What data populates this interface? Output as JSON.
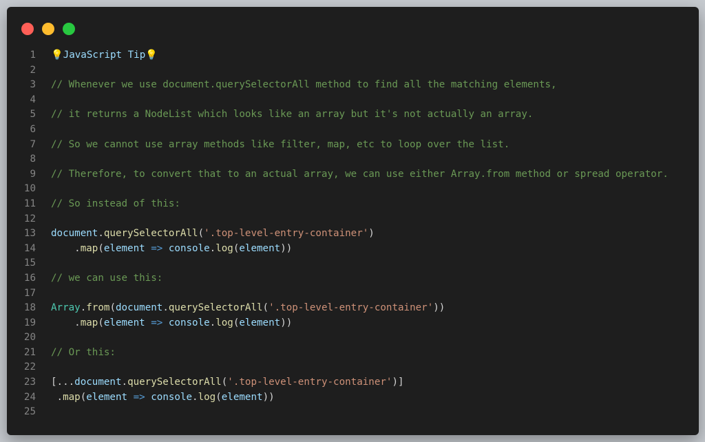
{
  "window": {
    "traffic_lights": {
      "close_color": "#ff5f57",
      "minimize_color": "#febc2e",
      "maximize_color": "#28c840"
    }
  },
  "code": {
    "lines": [
      {
        "n": "1",
        "tokens": [
          {
            "t": "bulb",
            "v": "💡"
          },
          {
            "t": "tip",
            "v": "JavaScript Tip"
          },
          {
            "t": "bulb",
            "v": "💡"
          }
        ]
      },
      {
        "n": "2",
        "tokens": []
      },
      {
        "n": "3",
        "tokens": [
          {
            "t": "cm",
            "v": "// Whenever we use document.querySelectorAll method to find all the matching elements,"
          }
        ]
      },
      {
        "n": "4",
        "tokens": []
      },
      {
        "n": "5",
        "tokens": [
          {
            "t": "cm",
            "v": "// it returns a NodeList which looks like an array but it's not actually an array."
          }
        ]
      },
      {
        "n": "6",
        "tokens": []
      },
      {
        "n": "7",
        "tokens": [
          {
            "t": "cm",
            "v": "// So we cannot use array methods like filter, map, etc to loop over the list."
          }
        ]
      },
      {
        "n": "8",
        "tokens": []
      },
      {
        "n": "9",
        "tokens": [
          {
            "t": "cm",
            "v": "// Therefore, to convert that to an actual array, we can use either Array.from method or spread operator."
          }
        ]
      },
      {
        "n": "10",
        "tokens": []
      },
      {
        "n": "11",
        "tokens": [
          {
            "t": "cm",
            "v": "// So instead of this:"
          }
        ]
      },
      {
        "n": "12",
        "tokens": []
      },
      {
        "n": "13",
        "tokens": [
          {
            "t": "vr",
            "v": "document"
          },
          {
            "t": "pl",
            "v": "."
          },
          {
            "t": "fn",
            "v": "querySelectorAll"
          },
          {
            "t": "pl",
            "v": "("
          },
          {
            "t": "st",
            "v": "'.top-level-entry-container'"
          },
          {
            "t": "pl",
            "v": ")"
          }
        ]
      },
      {
        "n": "14",
        "tokens": [
          {
            "t": "pl",
            "v": "    ."
          },
          {
            "t": "fn",
            "v": "map"
          },
          {
            "t": "pl",
            "v": "("
          },
          {
            "t": "vr",
            "v": "element"
          },
          {
            "t": "pl",
            "v": " "
          },
          {
            "t": "kw",
            "v": "=>"
          },
          {
            "t": "pl",
            "v": " "
          },
          {
            "t": "vr",
            "v": "console"
          },
          {
            "t": "pl",
            "v": "."
          },
          {
            "t": "fn",
            "v": "log"
          },
          {
            "t": "pl",
            "v": "("
          },
          {
            "t": "vr",
            "v": "element"
          },
          {
            "t": "pl",
            "v": "))"
          }
        ]
      },
      {
        "n": "15",
        "tokens": []
      },
      {
        "n": "16",
        "tokens": [
          {
            "t": "cm",
            "v": "// we can use this:"
          }
        ]
      },
      {
        "n": "17",
        "tokens": []
      },
      {
        "n": "18",
        "tokens": [
          {
            "t": "cl",
            "v": "Array"
          },
          {
            "t": "pl",
            "v": "."
          },
          {
            "t": "fn",
            "v": "from"
          },
          {
            "t": "pl",
            "v": "("
          },
          {
            "t": "vr",
            "v": "document"
          },
          {
            "t": "pl",
            "v": "."
          },
          {
            "t": "fn",
            "v": "querySelectorAll"
          },
          {
            "t": "pl",
            "v": "("
          },
          {
            "t": "st",
            "v": "'.top-level-entry-container'"
          },
          {
            "t": "pl",
            "v": "))"
          }
        ]
      },
      {
        "n": "19",
        "tokens": [
          {
            "t": "pl",
            "v": "    ."
          },
          {
            "t": "fn",
            "v": "map"
          },
          {
            "t": "pl",
            "v": "("
          },
          {
            "t": "vr",
            "v": "element"
          },
          {
            "t": "pl",
            "v": " "
          },
          {
            "t": "kw",
            "v": "=>"
          },
          {
            "t": "pl",
            "v": " "
          },
          {
            "t": "vr",
            "v": "console"
          },
          {
            "t": "pl",
            "v": "."
          },
          {
            "t": "fn",
            "v": "log"
          },
          {
            "t": "pl",
            "v": "("
          },
          {
            "t": "vr",
            "v": "element"
          },
          {
            "t": "pl",
            "v": "))"
          }
        ]
      },
      {
        "n": "20",
        "tokens": []
      },
      {
        "n": "21",
        "tokens": [
          {
            "t": "cm",
            "v": "// Or this:"
          }
        ]
      },
      {
        "n": "22",
        "tokens": []
      },
      {
        "n": "23",
        "tokens": [
          {
            "t": "pl",
            "v": "[..."
          },
          {
            "t": "vr",
            "v": "document"
          },
          {
            "t": "pl",
            "v": "."
          },
          {
            "t": "fn",
            "v": "querySelectorAll"
          },
          {
            "t": "pl",
            "v": "("
          },
          {
            "t": "st",
            "v": "'.top-level-entry-container'"
          },
          {
            "t": "pl",
            "v": ")]"
          }
        ]
      },
      {
        "n": "24",
        "tokens": [
          {
            "t": "pl",
            "v": " ."
          },
          {
            "t": "fn",
            "v": "map"
          },
          {
            "t": "pl",
            "v": "("
          },
          {
            "t": "vr",
            "v": "element"
          },
          {
            "t": "pl",
            "v": " "
          },
          {
            "t": "kw",
            "v": "=>"
          },
          {
            "t": "pl",
            "v": " "
          },
          {
            "t": "vr",
            "v": "console"
          },
          {
            "t": "pl",
            "v": "."
          },
          {
            "t": "fn",
            "v": "log"
          },
          {
            "t": "pl",
            "v": "("
          },
          {
            "t": "vr",
            "v": "element"
          },
          {
            "t": "pl",
            "v": "))"
          }
        ]
      },
      {
        "n": "25",
        "tokens": []
      }
    ]
  }
}
